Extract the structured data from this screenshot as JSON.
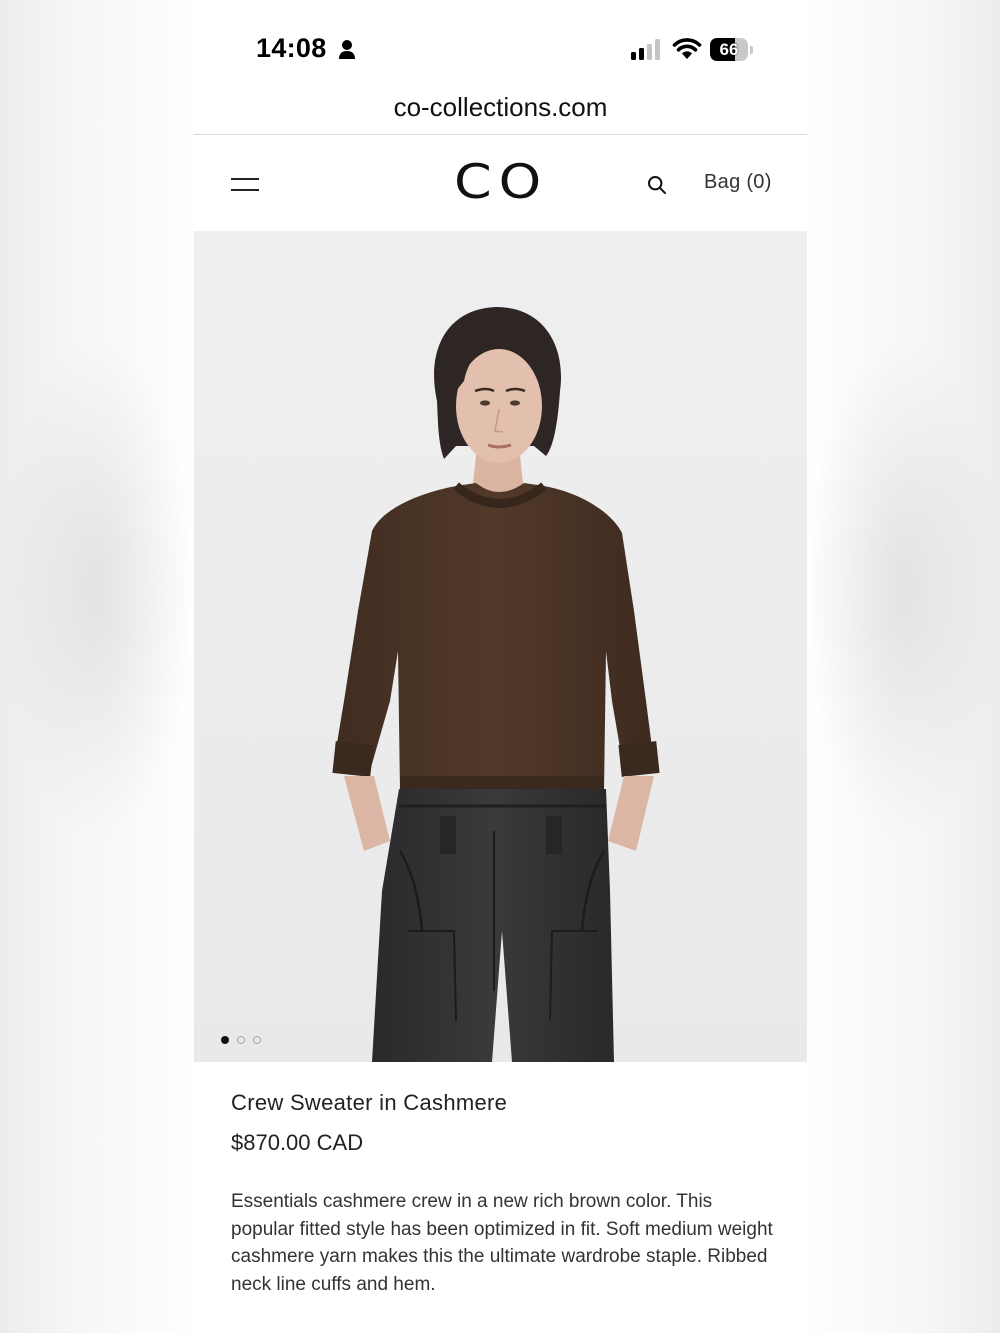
{
  "status_bar": {
    "time": "14:08",
    "battery_percent": 66,
    "battery_label": "66"
  },
  "browser": {
    "url": "co-collections.com"
  },
  "header": {
    "logo": "CO",
    "bag_label": "Bag (0)"
  },
  "gallery": {
    "image_count": 3,
    "active_index": 0
  },
  "product": {
    "name": "Crew Sweater in Cashmere",
    "price": "$870.00 CAD",
    "description": "Essentials cashmere crew in a new rich brown color. This popular fitted style has been optimized in fit. Soft medium weight cashmere yarn makes this the ultimate wardrobe staple. Ribbed neck line cuffs and hem."
  },
  "colors": {
    "sweater_brown": "#4a3426",
    "jeans_charcoal": "#2f2f31",
    "image_background": "#eeeeef"
  }
}
